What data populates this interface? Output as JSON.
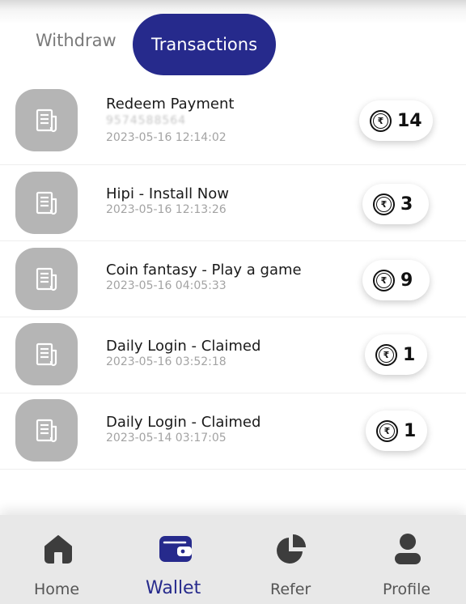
{
  "tabs": {
    "withdraw": "Withdraw",
    "transactions": "Transactions",
    "active": "Transactions"
  },
  "transactions": [
    {
      "title": "Redeem Payment",
      "subtitle": "9574588564",
      "date": "2023-05-16 12:14:02",
      "amount": "14",
      "icon": "receipt-icon"
    },
    {
      "title": "Hipi - Install Now",
      "date": "2023-05-16 12:13:26",
      "amount": "3",
      "icon": "receipt-icon"
    },
    {
      "title": "Coin fantasy - Play a game",
      "date": "2023-05-16 04:05:33",
      "amount": "9",
      "icon": "receipt-icon"
    },
    {
      "title": "Daily Login - Claimed",
      "date": "2023-05-16 03:52:18",
      "amount": "1",
      "icon": "receipt-icon"
    },
    {
      "title": "Daily Login - Claimed",
      "date": "2023-05-14 03:17:05",
      "amount": "1",
      "icon": "receipt-icon"
    }
  ],
  "coin_symbol": "₹",
  "nav": {
    "home": "Home",
    "wallet": "Wallet",
    "refer": "Refer",
    "profile": "Profile",
    "active": "Wallet"
  },
  "colors": {
    "accent": "#262a8c",
    "icon_tile": "#b5b5b5",
    "nav_background": "#e8e8e8",
    "nav_icon": "#3d3d3d"
  }
}
